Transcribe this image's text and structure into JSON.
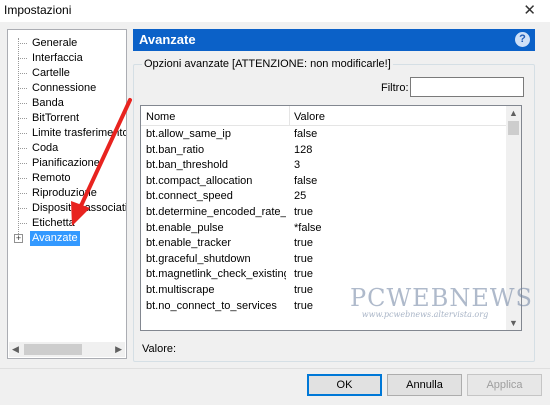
{
  "window": {
    "title": "Impostazioni",
    "close_glyph": "✕"
  },
  "sidebar": {
    "items": [
      {
        "label": "Generale"
      },
      {
        "label": "Interfaccia"
      },
      {
        "label": "Cartelle"
      },
      {
        "label": "Connessione"
      },
      {
        "label": "Banda"
      },
      {
        "label": "BitTorrent"
      },
      {
        "label": "Limite trasferimento"
      },
      {
        "label": "Coda"
      },
      {
        "label": "Pianificazione"
      },
      {
        "label": "Remoto"
      },
      {
        "label": "Riproduzione"
      },
      {
        "label": "Dispositivi associati"
      },
      {
        "label": "Etichetta"
      },
      {
        "label": "Avanzate",
        "selected": true,
        "expander": "+"
      }
    ]
  },
  "panel": {
    "title": "Avanzate",
    "help_glyph": "?",
    "group_title": "Opzioni avanzate [ATTENZIONE: non modificarle!]",
    "filter_label": "Filtro:",
    "filter_value": "",
    "columns": {
      "name": "Nome",
      "value": "Valore"
    },
    "rows": [
      {
        "name": "bt.allow_same_ip",
        "value": "false"
      },
      {
        "name": "bt.ban_ratio",
        "value": "128"
      },
      {
        "name": "bt.ban_threshold",
        "value": "3"
      },
      {
        "name": "bt.compact_allocation",
        "value": "false"
      },
      {
        "name": "bt.connect_speed",
        "value": "25"
      },
      {
        "name": "bt.determine_encoded_rate_fo...",
        "value": "true"
      },
      {
        "name": "bt.enable_pulse",
        "value": "*false"
      },
      {
        "name": "bt.enable_tracker",
        "value": "true"
      },
      {
        "name": "bt.graceful_shutdown",
        "value": "true"
      },
      {
        "name": "bt.magnetlink_check_existing_...",
        "value": "true"
      },
      {
        "name": "bt.multiscrape",
        "value": "true"
      },
      {
        "name": "bt.no_connect_to_services",
        "value": "true"
      }
    ],
    "value_label": "Valore:"
  },
  "buttons": {
    "ok": "OK",
    "cancel": "Annulla",
    "apply": "Applica"
  },
  "watermark": {
    "line1": "PCWEBNEWS",
    "line2": "www.pcwebnews.altervista.org"
  },
  "colors": {
    "header": "#0b61c8",
    "selection": "#3399ff",
    "arrow": "#e8231f"
  }
}
